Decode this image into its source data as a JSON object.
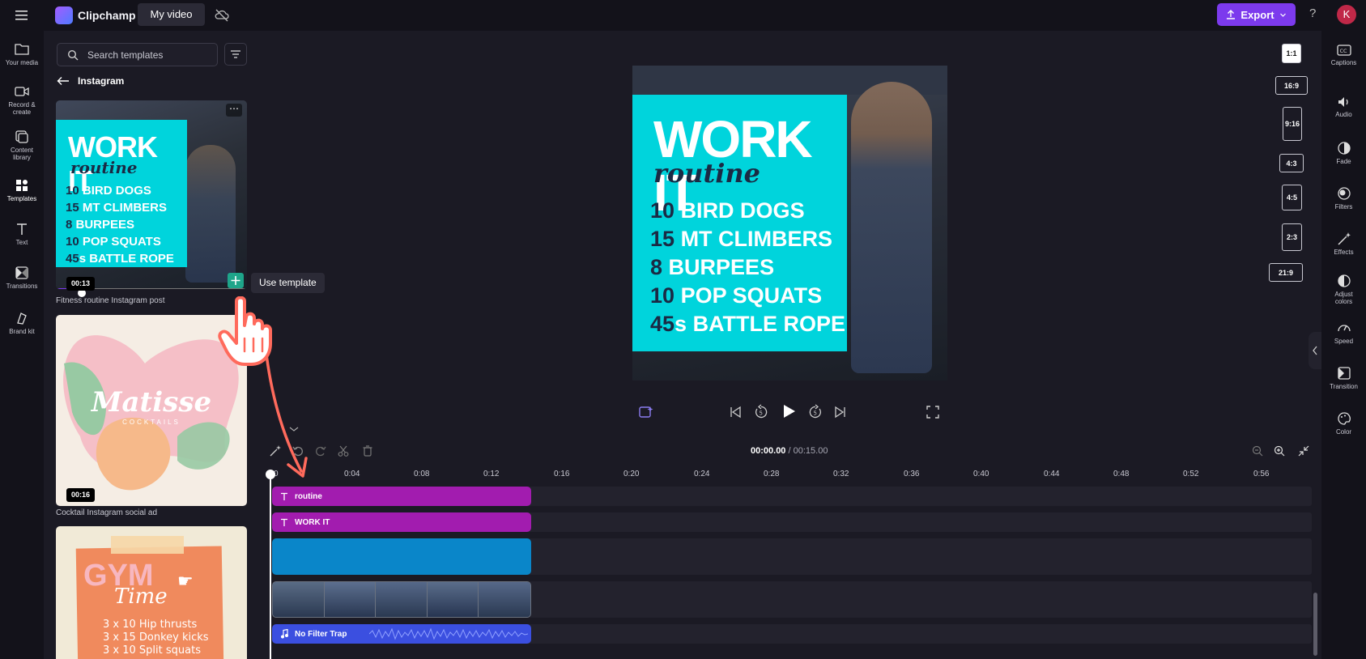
{
  "topbar": {
    "brand": "Clipchamp",
    "project_name": "My video",
    "export_label": "Export",
    "help": "?",
    "avatar_initial": "K"
  },
  "leftnav": {
    "items": [
      {
        "label": "Your media",
        "icon": "folder-icon"
      },
      {
        "label": "Record & create",
        "icon": "camera-icon"
      },
      {
        "label": "Content library",
        "icon": "library-icon"
      },
      {
        "label": "Templates",
        "icon": "templates-icon"
      },
      {
        "label": "Text",
        "icon": "text-icon"
      },
      {
        "label": "Transitions",
        "icon": "transitions-icon"
      },
      {
        "label": "Brand kit",
        "icon": "brand-kit-icon"
      }
    ]
  },
  "panel": {
    "search_placeholder": "Search templates",
    "section_title": "Instagram",
    "tooltip": "Use template",
    "templates": [
      {
        "caption": "Fitness routine Instagram post",
        "duration": "00:13",
        "title": "WORK IT",
        "script": "routine",
        "lines": [
          {
            "num": "10",
            "text": "BIRD DOGS"
          },
          {
            "num": "15",
            "text": "MT CLIMBERS"
          },
          {
            "num": "8",
            "text": "BURPEES"
          },
          {
            "num": "10",
            "text": "POP SQUATS"
          },
          {
            "num": "45",
            "text": "s BATTLE ROPE"
          }
        ]
      },
      {
        "caption": "Cocktail Instagram social ad",
        "duration": "00:16",
        "title": "Matisse",
        "subtitle": "COCKTAILS"
      },
      {
        "title": "GYM",
        "script": "Time",
        "lines": [
          "3 x 10 Hip thrusts",
          "3 x 15 Donkey kicks",
          "3 x 10 Split squats"
        ]
      }
    ]
  },
  "preview": {
    "title": "WORK IT",
    "script": "routine",
    "lines": [
      {
        "num": "10",
        "text": "BIRD DOGS"
      },
      {
        "num": "15",
        "text": "MT CLIMBERS"
      },
      {
        "num": "8",
        "text": "BURPEES"
      },
      {
        "num": "10",
        "text": "POP SQUATS"
      },
      {
        "num": "45",
        "text": "s BATTLE ROPE"
      }
    ],
    "ratios": [
      "1:1",
      "16:9",
      "9:16",
      "4:3",
      "4:5",
      "2:3",
      "21:9"
    ],
    "selected_ratio": "1:1"
  },
  "rightrail": {
    "items": [
      {
        "label": "Captions",
        "icon": "captions-icon"
      },
      {
        "label": "Audio",
        "icon": "speaker-icon"
      },
      {
        "label": "Fade",
        "icon": "fade-icon"
      },
      {
        "label": "Filters",
        "icon": "filters-icon"
      },
      {
        "label": "Effects",
        "icon": "magic-wand-icon"
      },
      {
        "label": "Adjust colors",
        "icon": "adjust-icon"
      },
      {
        "label": "Speed",
        "icon": "speedometer-icon"
      },
      {
        "label": "Transition",
        "icon": "transition-icon"
      },
      {
        "label": "Color",
        "icon": "palette-icon"
      }
    ]
  },
  "timeline": {
    "current_time": "00:00.00",
    "total_time": "/ 00:15.00",
    "ruler": [
      "0",
      "0:04",
      "0:08",
      "0:12",
      "0:16",
      "0:20",
      "0:24",
      "0:28",
      "0:32",
      "0:36",
      "0:40",
      "0:44",
      "0:48",
      "0:52",
      "0:56"
    ],
    "tracks": [
      {
        "label": "routine",
        "type": "text",
        "color": "#a21caf"
      },
      {
        "label": "WORK IT",
        "type": "text",
        "color": "#a21caf"
      },
      {
        "label": "",
        "type": "shape",
        "color": "#0a86c9"
      },
      {
        "label": "",
        "type": "video",
        "color": "#2b3a4f"
      },
      {
        "label": "No Filter Trap",
        "type": "audio",
        "color": "#3b4fe0"
      }
    ]
  },
  "colors": {
    "accent": "#7c3aed",
    "cyan": "#00d4dc",
    "text_clip": "#a21caf",
    "audio_clip": "#3b4fe0"
  }
}
